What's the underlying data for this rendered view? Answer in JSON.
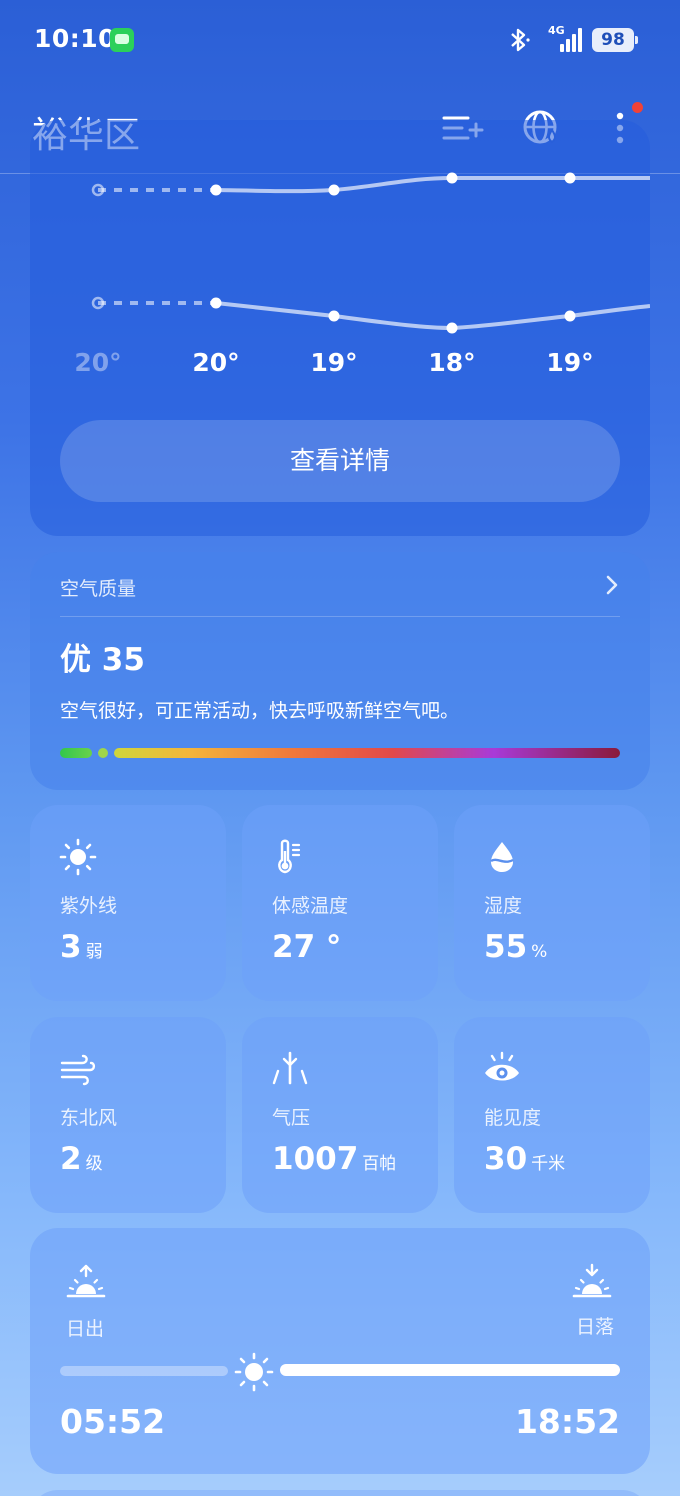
{
  "status": {
    "time": "10:10",
    "network": "4G",
    "battery": "98"
  },
  "header": {
    "city": "裕华区"
  },
  "forecast": {
    "temps": [
      "20°",
      "20°",
      "19°",
      "18°",
      "19°"
    ],
    "details_label": "查看详情"
  },
  "air_quality": {
    "title": "空气质量",
    "value": "优 35",
    "description": "空气很好，可正常活动，快去呼吸新鲜空气吧。"
  },
  "tiles": [
    {
      "label": "紫外线",
      "value": "3",
      "unit": "弱",
      "icon": "sun-icon"
    },
    {
      "label": "体感温度",
      "value": "27 °",
      "unit": "",
      "icon": "thermometer-icon"
    },
    {
      "label": "湿度",
      "value": "55",
      "unit": "%",
      "icon": "water-drop-icon"
    },
    {
      "label": "东北风",
      "value": "2",
      "unit": "级",
      "icon": "wind-icon"
    },
    {
      "label": "气压",
      "value": "1007",
      "unit": "百帕",
      "icon": "pressure-icon"
    },
    {
      "label": "能见度",
      "value": "30",
      "unit": "千米",
      "icon": "eye-icon"
    }
  ],
  "sun": {
    "sunrise_label": "日出",
    "sunset_label": "日落",
    "sunrise_time": "05:52",
    "sunset_time": "18:52"
  },
  "colors": {
    "accent_dot": "#f04238",
    "background_top": "#2b5fd6",
    "background_bottom": "#a6cdfc"
  }
}
